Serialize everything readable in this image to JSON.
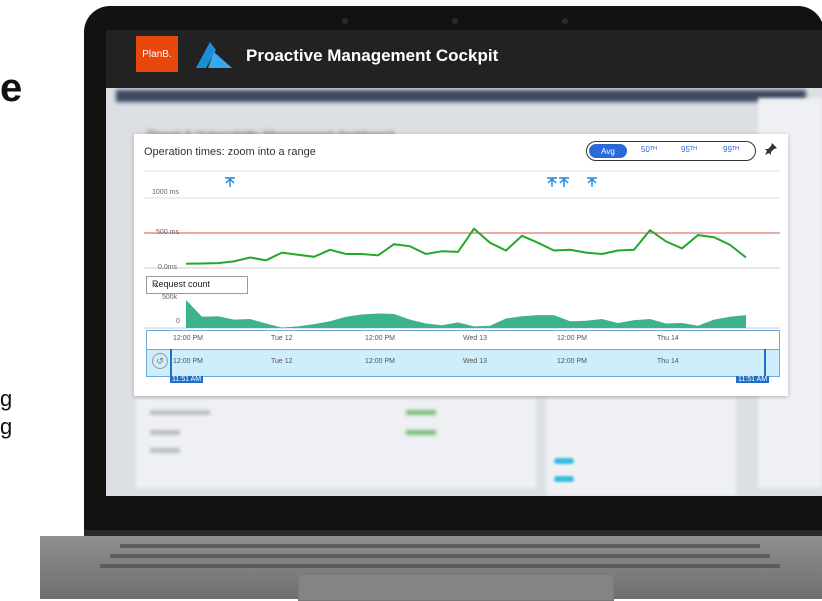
{
  "app": {
    "brand_logo": "PlanB.",
    "title": "Proactive Management Cockpit",
    "azure_icon": "azure-logo-icon"
  },
  "side_text": {
    "big_letter": "e",
    "line1": "g",
    "line2": "g"
  },
  "chart_panel": {
    "title": "Operation times: zoom into a range",
    "percentile_options": [
      "Avg",
      "50ᵀᴴ",
      "95ᵀᴴ",
      "99ᵀᴴ"
    ],
    "selected_percentile": "Avg",
    "pin_icon": "pin-icon",
    "metric_dropdown": "Request count"
  },
  "chart_data": [
    {
      "type": "line",
      "title": "",
      "ylim": [
        0,
        1000
      ],
      "y_ticks": [
        "1000 ms",
        "500 ms",
        "0.0ms"
      ],
      "threshold": 500,
      "colors": {
        "line": "#22a82a",
        "threshold": "#d9534f"
      },
      "series": [
        {
          "values": [
            60,
            65,
            70,
            95,
            150,
            110,
            220,
            190,
            160,
            260,
            200,
            200,
            180,
            340,
            310,
            200,
            240,
            230,
            560,
            360,
            250,
            460,
            360,
            250,
            260,
            220,
            200,
            250,
            260,
            540,
            380,
            280,
            470,
            440,
            330,
            150
          ]
        }
      ]
    },
    {
      "type": "area",
      "title": "",
      "ylim": [
        0,
        500
      ],
      "y_ticks": [
        "500k",
        "0"
      ],
      "colors": {
        "fill": "#3cb38a"
      },
      "series": [
        {
          "values": [
            500,
            200,
            210,
            150,
            160,
            80,
            10,
            30,
            70,
            120,
            200,
            240,
            260,
            250,
            150,
            80,
            50,
            100,
            30,
            40,
            170,
            210,
            230,
            230,
            120,
            130,
            160,
            90,
            140,
            160,
            80,
            90,
            40,
            150,
            200,
            230
          ]
        }
      ]
    }
  ],
  "timeline": {
    "labels": [
      "12:00 PM",
      "Tue 12",
      "12:00 PM",
      "Wed 13",
      "12:00 PM",
      "Thu 14"
    ],
    "start_handle": "11:51 AM",
    "end_handle": "11:51 AM"
  }
}
